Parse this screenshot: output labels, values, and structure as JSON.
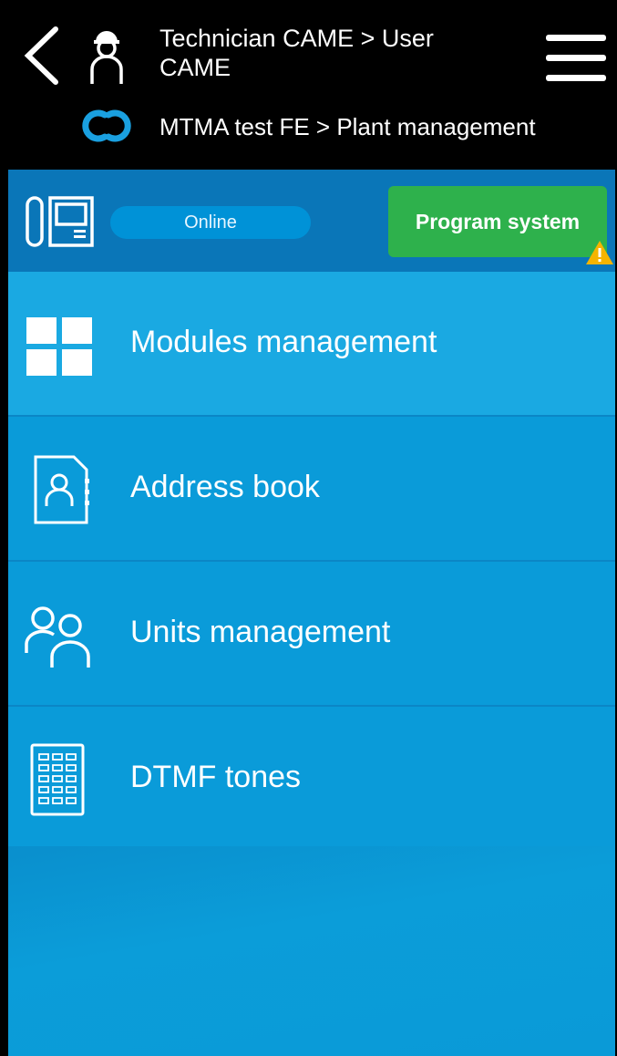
{
  "header": {
    "breadcrumb_top": "Technician CAME > User CAME",
    "breadcrumb_bottom": "MTMA test FE > Plant management",
    "back_icon": "chevron-left-icon",
    "user_icon": "technician-icon",
    "menu_icon": "hamburger-icon",
    "cloud_icon": "came-cloud-icon"
  },
  "status": {
    "online_label": "Online",
    "program_label": "Program system",
    "device_icon": "intercom-device-icon",
    "warning_icon": "warning-icon"
  },
  "menu": {
    "items": [
      {
        "label": "Modules management",
        "icon": "modules-grid-icon"
      },
      {
        "label": "Address book",
        "icon": "address-book-icon"
      },
      {
        "label": "Units management",
        "icon": "users-icon"
      },
      {
        "label": "DTMF tones",
        "icon": "keypad-icon"
      }
    ]
  },
  "colors": {
    "header_bg": "#000000",
    "status_bg": "#0a76b8",
    "online_pill": "#0092d7",
    "program_button": "#2eb14c",
    "menu_bg": "#0a9bd9",
    "menu_active_bg": "#1aa9e2",
    "warning": "#f5b400"
  }
}
